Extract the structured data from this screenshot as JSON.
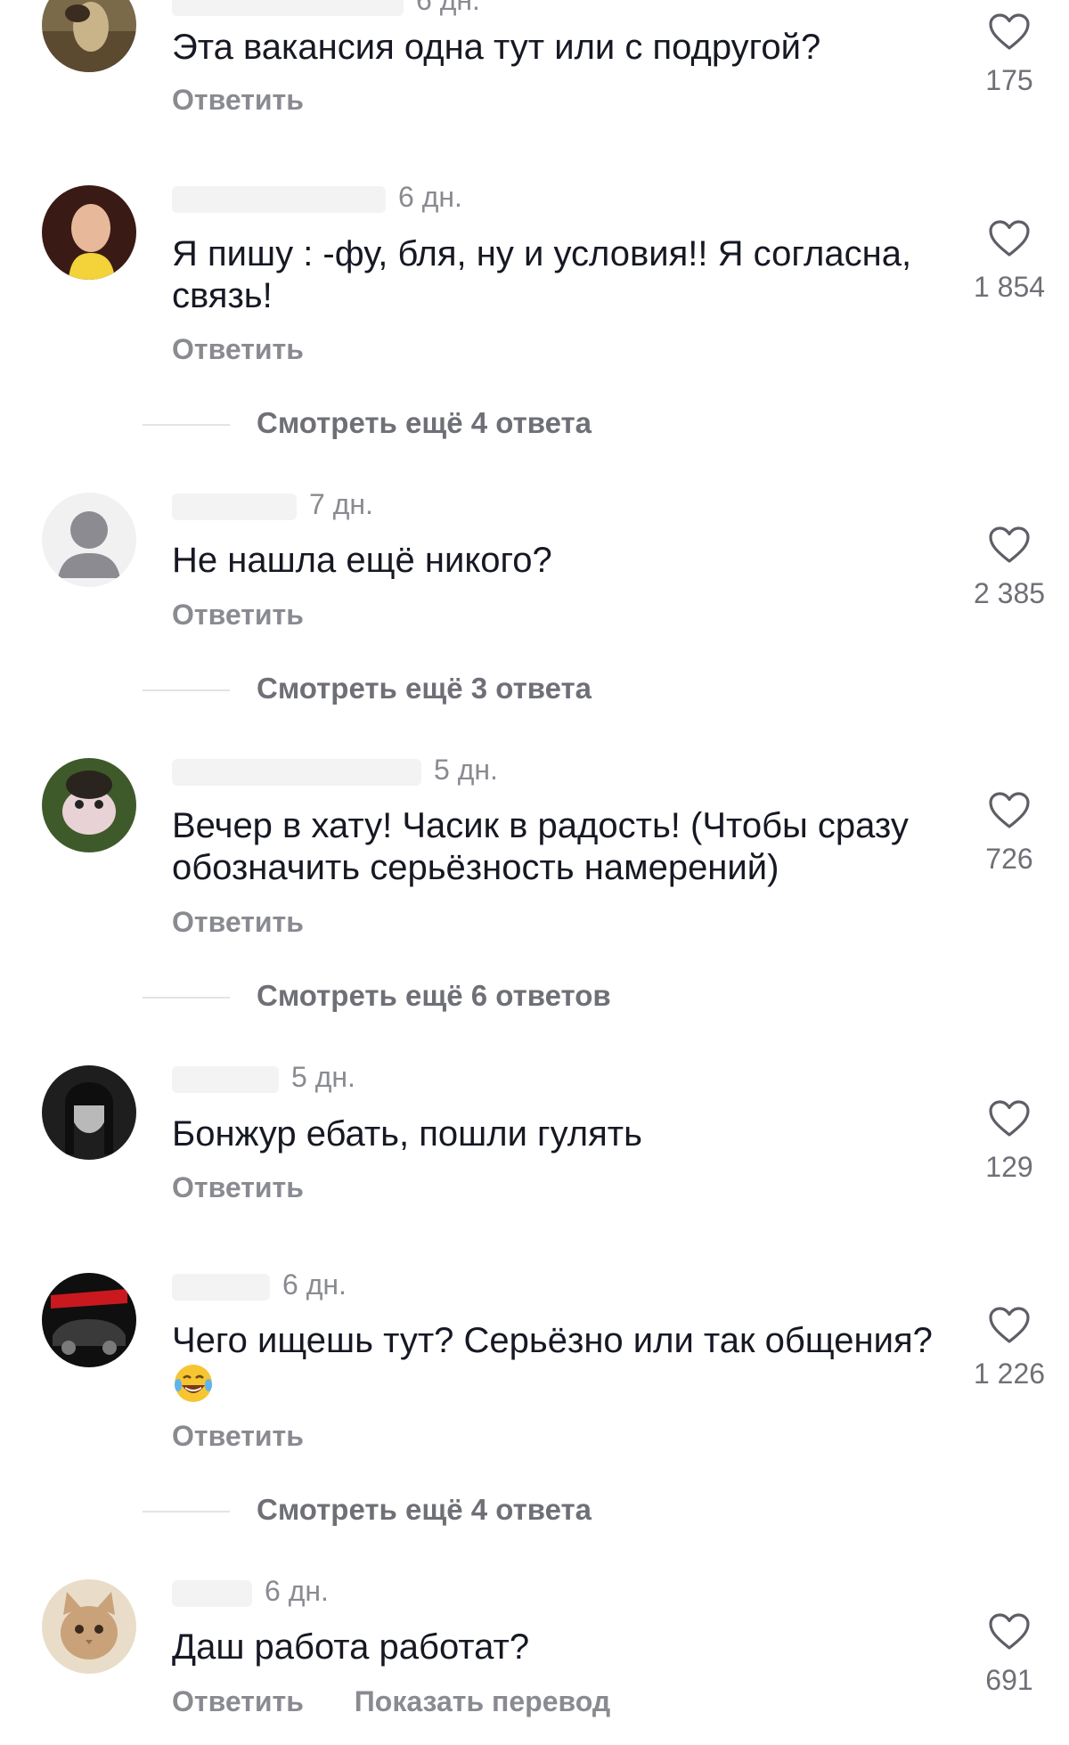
{
  "comments": [
    {
      "time": "6 дн.",
      "text": "Эта вакансия одна тут или с подругой?",
      "reply": "Ответить",
      "likes": "175",
      "avatar_icon": "painting-avatar"
    },
    {
      "time": "6 дн.",
      "text": "Я пишу : -фу, бля, ну и условия!! Я согласна, связь!",
      "reply": "Ответить",
      "likes": "1 854",
      "avatar_icon": "woman-photo-avatar",
      "more_replies": "Смотреть ещё 4 ответа"
    },
    {
      "time": "7 дн.",
      "text": "Не нашла ещё никого?",
      "reply": "Ответить",
      "likes": "2 385",
      "avatar_icon": "default-user-avatar",
      "more_replies": "Смотреть ещё 3 ответа"
    },
    {
      "time": "5 дн.",
      "text": "Вечер в хату! Часик в радость! (Чтобы сразу обозначить серьёзность намерений)",
      "reply": "Ответить",
      "likes": "726",
      "avatar_icon": "puppet-avatar",
      "more_replies": "Смотреть ещё 6 ответов"
    },
    {
      "time": "5 дн.",
      "text": "Бонжур ебать, пошли гулять",
      "reply": "Ответить",
      "likes": "129",
      "avatar_icon": "bw-portrait-avatar"
    },
    {
      "time": "6 дн.",
      "text": "Чего ищешь тут? Серьёзно или так общения?",
      "emoji": "laughing-tears-emoji",
      "reply": "Ответить",
      "likes": "1 226",
      "avatar_icon": "car-avatar",
      "more_replies": "Смотреть ещё 4 ответа"
    },
    {
      "time": "6 дн.",
      "text": "Даш работа работат?",
      "reply": "Ответить",
      "translate": "Показать перевод",
      "likes": "691",
      "avatar_icon": "cat-avatar"
    }
  ],
  "colors": {
    "text": "#161823",
    "muted": "#8a8b91",
    "background": "#ffffff"
  }
}
